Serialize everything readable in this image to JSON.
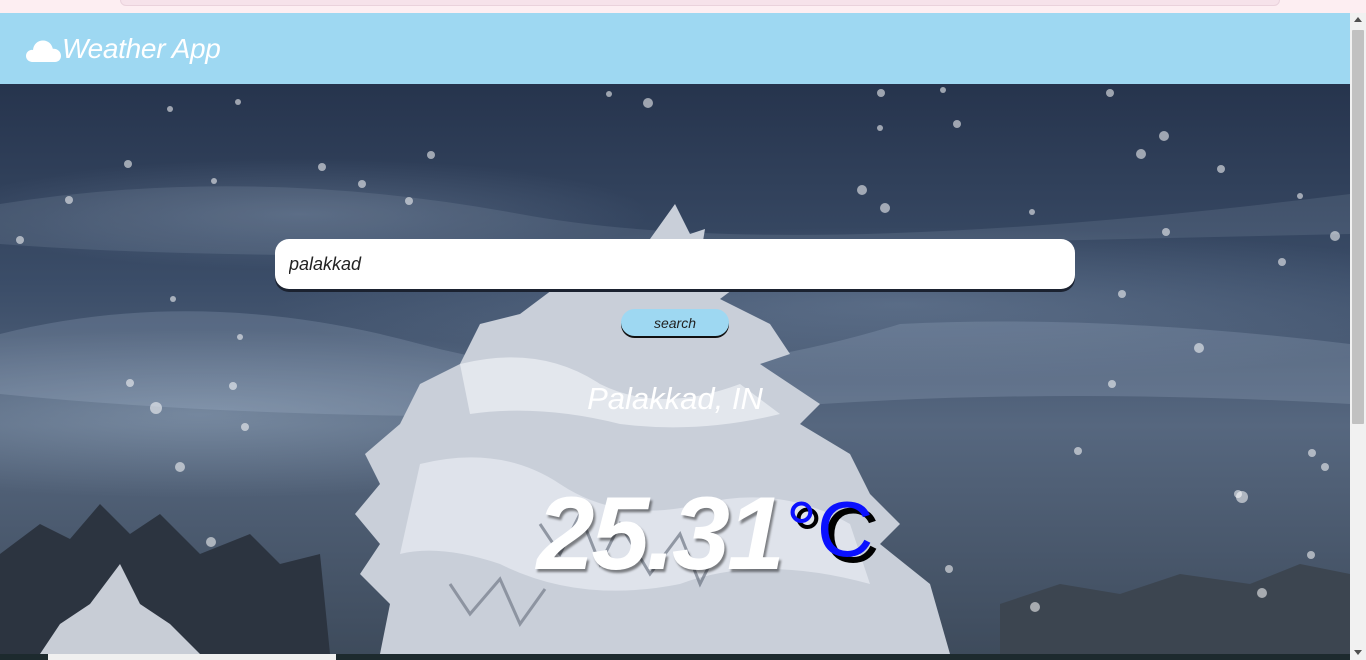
{
  "app": {
    "title": "Weather App",
    "logo_icon": "cloud-icon"
  },
  "search": {
    "value": "palakkad",
    "button_label": "search"
  },
  "weather": {
    "location": "Palakkad, IN",
    "temperature": "25.31",
    "unit": "°C"
  },
  "colors": {
    "navbar": "#9ed8f2",
    "unit_accent": "#0a10ff",
    "text": "#ffffff"
  }
}
